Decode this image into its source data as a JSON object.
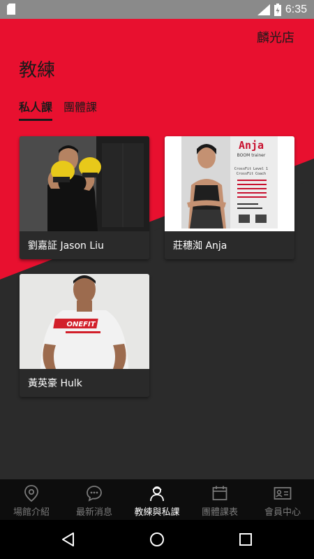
{
  "status_bar": {
    "time": "6:35",
    "network": "LTE"
  },
  "header": {
    "store": "麟光店",
    "title": "教練"
  },
  "tabs": [
    {
      "label": "私人課",
      "active": true
    },
    {
      "label": "團體課",
      "active": false
    }
  ],
  "coaches": [
    {
      "name": "劉嘉証 Jason Liu",
      "photo": "boxer-with-gloves"
    },
    {
      "name": "莊穗洳 Anja",
      "photo": "anja-poster"
    },
    {
      "name": "黃英豪 Hulk",
      "photo": "onefit-shirt"
    }
  ],
  "anja_poster": {
    "name": "Anja",
    "subtitle": "BOOM trainer",
    "lines": [
      "CrossFit Level 1",
      "CrossFit Coach"
    ]
  },
  "shirt_brand": "ONEFIT",
  "bottom_nav": [
    {
      "label": "場館介紹",
      "icon": "location-pin-icon",
      "active": false
    },
    {
      "label": "最新消息",
      "icon": "chat-bubble-icon",
      "active": false
    },
    {
      "label": "教練與私課",
      "icon": "coach-icon",
      "active": true
    },
    {
      "label": "團體課表",
      "icon": "calendar-icon",
      "active": false
    },
    {
      "label": "會員中心",
      "icon": "member-card-icon",
      "active": false
    }
  ],
  "colors": {
    "accent": "#e8102f",
    "dark_bg": "#2b2b2b",
    "nav_bg": "#0d0d0d"
  }
}
